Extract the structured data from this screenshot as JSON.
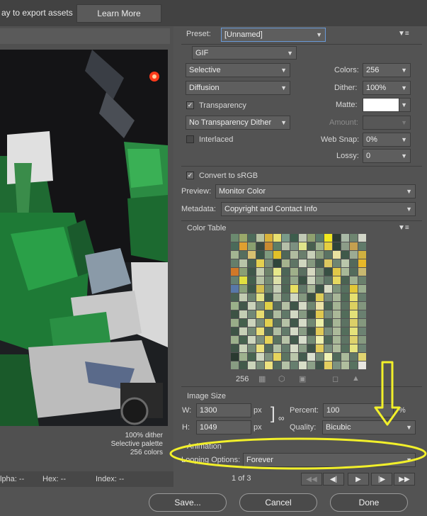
{
  "topbar": {
    "hint": "ay to export assets",
    "learn_more": "Learn More"
  },
  "preview": {
    "info": [
      "100% dither",
      "Selective palette",
      "256 colors"
    ],
    "status": {
      "alpha": "lpha: --",
      "hex": "Hex: --",
      "index": "Index: --"
    }
  },
  "settings": {
    "preset_label": "Preset:",
    "preset_value": "[Unnamed]",
    "format": "GIF",
    "reduction": "Selective",
    "dither_algo": "Diffusion",
    "transparency": "Transparency",
    "transparency_dither": "No Transparency Dither",
    "interlaced": "Interlaced",
    "colors_label": "Colors:",
    "colors_value": "256",
    "dither_label": "Dither:",
    "dither_value": "100%",
    "matte_label": "Matte:",
    "amount_label": "Amount:",
    "websnap_label": "Web Snap:",
    "websnap_value": "0%",
    "lossy_label": "Lossy:",
    "lossy_value": "0",
    "convert_srgb": "Convert to sRGB",
    "preview_label": "Preview:",
    "preview_value": "Monitor Color",
    "metadata_label": "Metadata:",
    "metadata_value": "Copyright and Contact Info"
  },
  "color_table": {
    "title": "Color Table",
    "count": "256",
    "colors": [
      "#6b8a6f",
      "#9aa86a",
      "#4d6b5a",
      "#b7c3a0",
      "#d9b33a",
      "#e8e070",
      "#7a9b8a",
      "#3d5d4c",
      "#c0c9b4",
      "#8fa06f",
      "#5a7a6b",
      "#f0e820",
      "#2c3b33",
      "#a9b9a6",
      "#6e8570",
      "#d2d6c8",
      "#4a6a5a",
      "#e0a030",
      "#8aa070",
      "#3a4a40",
      "#c98a32",
      "#5d7d65",
      "#b5bfa8",
      "#7c9080",
      "#dfe58a",
      "#49604f",
      "#9bb08c",
      "#e6cf40",
      "#2e443a",
      "#8c9c88",
      "#c4a050",
      "#607a6a",
      "#a3b592",
      "#566e5e",
      "#d8c070",
      "#3c5648",
      "#7f9a7e",
      "#e2c028",
      "#4f6658",
      "#b0bca0",
      "#6a7e6c",
      "#c8cfb8",
      "#8d9f7c",
      "#5b7363",
      "#eae0a0",
      "#40594a",
      "#9cab94",
      "#d0b040",
      "#657e6a",
      "#b8c4a8",
      "#4b6353",
      "#e4d050",
      "#7a8e78",
      "#2f463a",
      "#a5b38e",
      "#5f7565",
      "#cfd7bf",
      "#86997f",
      "#485e51",
      "#dcc860",
      "#6f8572",
      "#bac6ab",
      "#53695b",
      "#e8b828",
      "#d07828",
      "#8a9f74",
      "#3f574a",
      "#c4cdb0",
      "#6d8269",
      "#e6e88a",
      "#4c6557",
      "#9fb08a",
      "#5a6f60",
      "#d6d8c0",
      "#7b9078",
      "#385044",
      "#e0c848",
      "#a8b898",
      "#546c5c",
      "#c8b870",
      "#668070",
      "#e0e040",
      "#44604e",
      "#b6c2a4",
      "#738a74",
      "#dce0a8",
      "#526a5a",
      "#94a88a",
      "#3a5244",
      "#cdd5bd",
      "#80957d",
      "#5e7666",
      "#e6d860",
      "#4a6252",
      "#a0b292",
      "#6a806c",
      "#5878a8",
      "#8aa27a",
      "#3e5849",
      "#d4c050",
      "#708870",
      "#c6cfb6",
      "#4e6656",
      "#e8e060",
      "#62796a",
      "#a6b696",
      "#3c5446",
      "#d8dcc4",
      "#7e947c",
      "#56705f",
      "#e2c838",
      "#9aae8e",
      "#486052",
      "#c2ccb2",
      "#6c8470",
      "#e4e488",
      "#405a4c",
      "#b2bea2",
      "#5c7464",
      "#d0d8c2",
      "#84987f",
      "#3a5042",
      "#dccc58",
      "#74887a",
      "#a8b698",
      "#506a58",
      "#e6e070",
      "#687e6e",
      "#9ab08a",
      "#42584a",
      "#cad2ba",
      "#788c78",
      "#e0d048",
      "#566c5e",
      "#b4c0a4",
      "#3e5648",
      "#d4dac6",
      "#6e8670",
      "#eae2a8",
      "#4a6454",
      "#a4b494",
      "#5a7060",
      "#dcd060",
      "#82967e",
      "#3c5244",
      "#c4ceb4",
      "#728876",
      "#e6dc70",
      "#4e6858",
      "#aebca0",
      "#607868",
      "#d2d8c4",
      "#869a82",
      "#3a4e42",
      "#dec850",
      "#768c7a",
      "#aab898",
      "#526c5a",
      "#e2e078",
      "#6a8070",
      "#98ac88",
      "#44604c",
      "#ccd4bc",
      "#7a8e7a",
      "#e2d050",
      "#58705e",
      "#b6c2a6",
      "#40584a",
      "#d6dcc8",
      "#708872",
      "#ecf0a8",
      "#4c6656",
      "#a6b696",
      "#5c7262",
      "#dcd068",
      "#84987e",
      "#3e5446",
      "#c6d0b6",
      "#748a76",
      "#e8de78",
      "#50685a",
      "#b0bea2",
      "#627a6a",
      "#d4dac6",
      "#889c84",
      "#3c5044",
      "#e0ca58",
      "#788e7c",
      "#acba9a",
      "#546e5c",
      "#e4e27a",
      "#6c8272",
      "#9cb08c",
      "#46624e",
      "#ced6be",
      "#7c907c",
      "#e4d258",
      "#5a7260",
      "#b8c4a8",
      "#425a4c",
      "#d8decc",
      "#728a74",
      "#eef0b0",
      "#4e6858",
      "#a8b898",
      "#5e7464",
      "#ded26c",
      "#869a80",
      "#405648",
      "#c8d2b8",
      "#768c78",
      "#eae07c",
      "#526a5c",
      "#b2c0a4",
      "#647c6c",
      "#d6dcc8",
      "#8a9e86",
      "#3e5246",
      "#e2cc5c",
      "#7a907e",
      "#aebc9c",
      "#56705e",
      "#e6e47e",
      "#6e8474",
      "#2a3a30",
      "#9eb28e",
      "#486450",
      "#d0d8c0",
      "#7e927e",
      "#e6d45c",
      "#5c7462",
      "#bac6aa",
      "#445c4e",
      "#dae0ce",
      "#748c76",
      "#f0f2b4",
      "#506a5a",
      "#aaba9a",
      "#607666",
      "#e0d470",
      "#889c82",
      "#425a4a",
      "#cad4ba",
      "#788e7a",
      "#ece280",
      "#546c5e",
      "#b4c2a6",
      "#667e6e",
      "#d8dec8",
      "#8ca088",
      "#40544a",
      "#e4ce60",
      "#7c9280",
      "#b0be9e",
      "#587260",
      "#e8e6e0"
    ]
  },
  "image_size": {
    "title": "Image Size",
    "w_label": "W:",
    "w_value": "1300",
    "h_label": "H:",
    "h_value": "1049",
    "unit": "px",
    "percent_label": "Percent:",
    "percent_value": "100",
    "percent_unit": "%",
    "quality_label": "Quality:",
    "quality_value": "Bicubic"
  },
  "animation": {
    "title": "Animation",
    "looping_label": "Looping Options:",
    "looping_value": "Forever",
    "frame": "1 of 3"
  },
  "buttons": {
    "save": "Save...",
    "cancel": "Cancel",
    "done": "Done"
  },
  "annotation_color": "#f2f02a"
}
